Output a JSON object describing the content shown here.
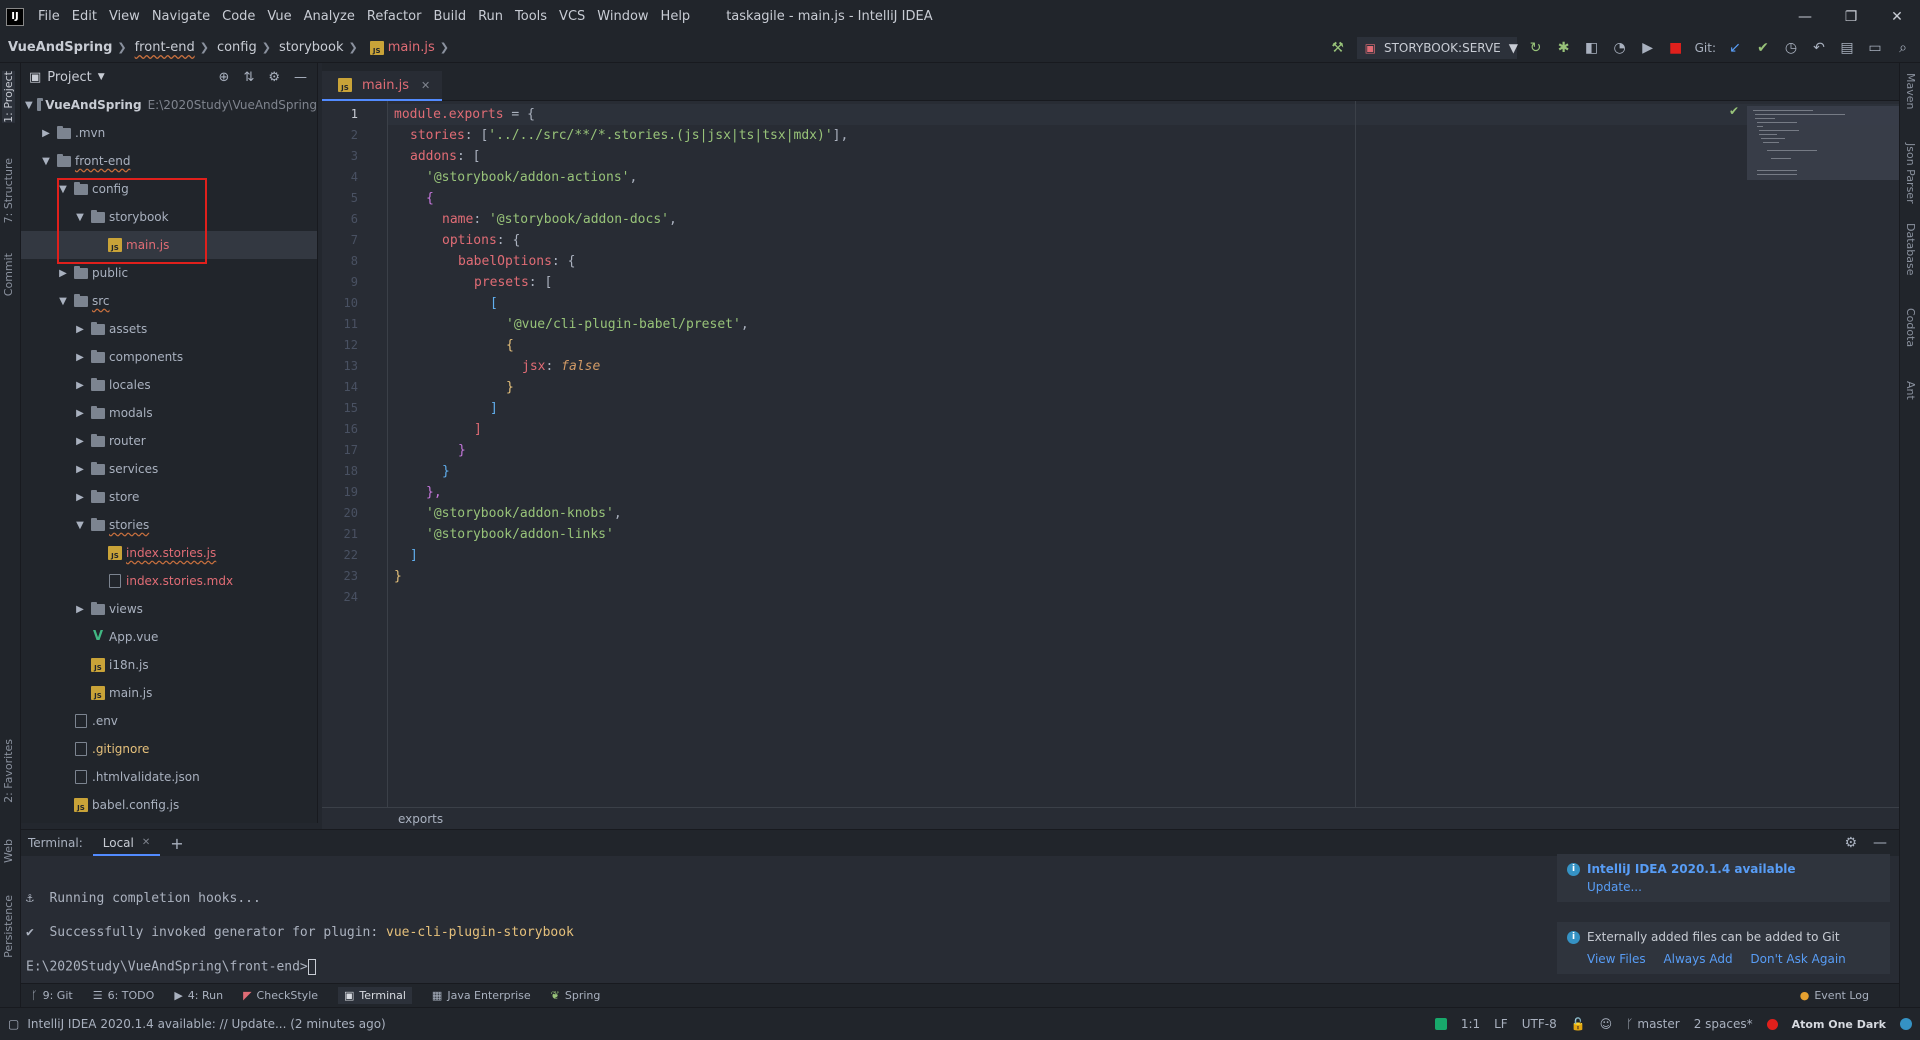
{
  "titlebar": {
    "logo": "IJ",
    "menu": [
      "File",
      "Edit",
      "View",
      "Navigate",
      "Code",
      "Vue",
      "Analyze",
      "Refactor",
      "Build",
      "Run",
      "Tools",
      "VCS",
      "Window",
      "Help"
    ],
    "window_title": "taskagile - main.js - IntelliJ IDEA",
    "minimize": "—",
    "restore": "❐",
    "close": "✕"
  },
  "navbar": {
    "breadcrumbs": [
      "VueAndSpring",
      "front-end",
      "config",
      "storybook",
      "main.js"
    ],
    "run_config": "STORYBOOK:SERVE",
    "git_label": "Git:"
  },
  "left_strip": {
    "tabs": [
      "1: Project",
      "7: Structure",
      "Commit",
      "2: Favorites",
      "Web",
      "Persistence"
    ]
  },
  "right_strip": {
    "tabs": [
      "Maven",
      "Json Parser",
      "Database",
      "Codota",
      "Ant"
    ]
  },
  "project": {
    "header_label": "Project",
    "root_name": "VueAndSpring",
    "root_path": "E:\\2020Study\\VueAndSpring",
    "tree": [
      {
        "name": ".mvn"
      },
      {
        "name": "front-end"
      },
      {
        "name": "config"
      },
      {
        "name": "storybook"
      },
      {
        "name": "main.js"
      },
      {
        "name": "public"
      },
      {
        "name": "src"
      },
      {
        "name": "assets"
      },
      {
        "name": "components"
      },
      {
        "name": "locales"
      },
      {
        "name": "modals"
      },
      {
        "name": "router"
      },
      {
        "name": "services"
      },
      {
        "name": "store"
      },
      {
        "name": "stories"
      },
      {
        "name": "index.stories.js"
      },
      {
        "name": "index.stories.mdx"
      },
      {
        "name": "views"
      },
      {
        "name": "App.vue"
      },
      {
        "name": "i18n.js"
      },
      {
        "name": "main.js"
      },
      {
        "name": ".env"
      },
      {
        "name": ".gitignore"
      },
      {
        "name": ".htmlvalidate.json"
      },
      {
        "name": "babel.config.js"
      }
    ]
  },
  "editor": {
    "tab_label": "main.js",
    "line_numbers": [
      "1",
      "2",
      "3",
      "4",
      "5",
      "6",
      "7",
      "8",
      "9",
      "10",
      "11",
      "12",
      "13",
      "14",
      "15",
      "16",
      "17",
      "18",
      "19",
      "20",
      "21",
      "22",
      "23",
      "24"
    ],
    "code": {
      "l1_a": "module",
      "l1_b": ".exports",
      "l1_c": " = {",
      "l2_a": "stories",
      "l2_b": ": [",
      "l2_c": "'../../src/**/*.stories.(js|jsx|ts|tsx|mdx)'",
      "l2_d": "],",
      "l3_a": "addons",
      "l3_b": ": [",
      "l4_a": "'@storybook/addon-actions'",
      "l4_b": ",",
      "l5_a": "{",
      "l6_a": "name",
      "l6_b": ": ",
      "l6_c": "'@storybook/addon-docs'",
      "l6_d": ",",
      "l7_a": "options",
      "l7_b": ": {",
      "l8_a": "babelOptions",
      "l8_b": ": {",
      "l9_a": "presets",
      "l9_b": ": [",
      "l10_a": "[",
      "l11_a": "'@vue/cli-plugin-babel/preset'",
      "l11_b": ",",
      "l12_a": "{",
      "l13_a": "jsx",
      "l13_b": ": ",
      "l13_c": "false",
      "l14_a": "}",
      "l15_a": "]",
      "l16_a": "]",
      "l17_a": "}",
      "l18_a": "}",
      "l19_a": "},",
      "l20_a": "'@storybook/addon-knobs'",
      "l20_b": ",",
      "l21_a": "'@storybook/addon-links'",
      "l22_a": "]",
      "l23_a": "}"
    },
    "breadcrumb": "exports"
  },
  "terminal": {
    "label": "Terminal:",
    "tab_local": "Local",
    "add": "+",
    "line1": "⚓  Running completion hooks...",
    "line2_prefix": "✔  Successfully invoked generator for plugin: ",
    "line2_plugin": "vue-cli-plugin-storybook",
    "prompt": "E:\\2020Study\\VueAndSpring\\front-end>"
  },
  "notifications": [
    {
      "title": "IntelliJ IDEA 2020.1.4 available",
      "links": [
        "Update..."
      ]
    },
    {
      "title": "Externally added files can be added to Git",
      "links": [
        "View Files",
        "Always Add",
        "Don't Ask Again"
      ]
    }
  ],
  "bottom_tools": [
    "9: Git",
    "6: TODO",
    "4: Run",
    "CheckStyle",
    "Terminal",
    "Java Enterprise",
    "Spring"
  ],
  "event_log": "Event Log",
  "statusbar": {
    "message": "IntelliJ IDEA 2020.1.4 available: // Update... (2 minutes ago)",
    "position": "1:1",
    "line_sep": "LF",
    "encoding": "UTF-8",
    "branch": "master",
    "indent": "2 spaces*",
    "theme": "Atom One Dark"
  },
  "colors": {
    "accent": "#528bff",
    "highlight_box": "#e0201c"
  }
}
